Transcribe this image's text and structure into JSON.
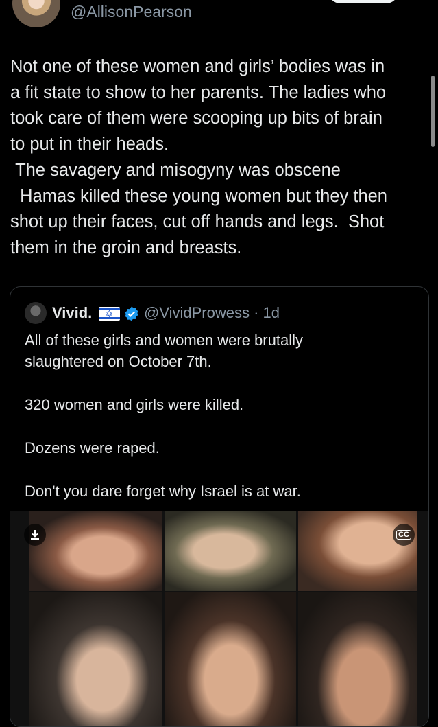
{
  "author": {
    "handle": "@AllisonPearson"
  },
  "tweet": {
    "text": "Not one of these women and girls’ bodies was in\na fit state to show to her parents. The ladies who\ntook care of them were scooping up bits of brain\nto put in their heads.\n The savagery and misogyny was obscene\n  Hamas killed these young women but they then\nshot up their faces, cut off hands and legs.  Shot\nthem in the groin and breasts."
  },
  "quote": {
    "name": "Vivid.",
    "handle_time": "@VividProwess · 1d",
    "text": "All of these girls and women were brutally\nslaughtered on October 7th.\n\n320 women and girls were killed.\n\nDozens were raped.\n\nDon't you dare forget why Israel is at war.",
    "media": {
      "download_icon": "download-icon",
      "captions_label": "CC"
    }
  },
  "colors": {
    "background": "#000000",
    "text": "#e7e9ea",
    "secondary": "#8b98a5",
    "verified": "#1d9bf0",
    "border": "#2f3336"
  }
}
